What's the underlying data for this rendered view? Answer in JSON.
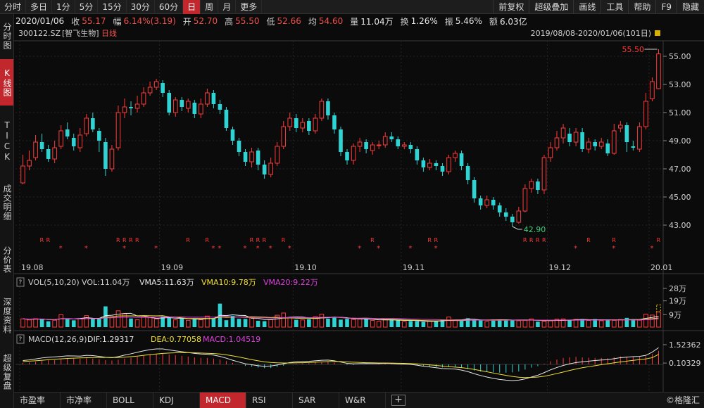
{
  "toolbar": {
    "left": [
      "分时",
      "多日",
      "1分",
      "5分",
      "15分",
      "30分",
      "60分",
      "日",
      "周",
      "月",
      "更多"
    ],
    "active": "日",
    "right": [
      "前复权",
      "超级叠加",
      "画线",
      "工具",
      "帮助",
      "F9",
      "隐藏"
    ]
  },
  "info": {
    "date": "2020/01/06",
    "close_label": "收",
    "close": "55.17",
    "change_label": "幅",
    "change": "6.14%(3.19)",
    "open_label": "开",
    "open": "52.70",
    "high_label": "高",
    "high": "55.50",
    "low_label": "低",
    "low": "52.66",
    "avg_label": "均",
    "avg": "54.60",
    "vol_label": "量",
    "vol": "11.04万",
    "turnover_label": "换",
    "turnover": "1.26%",
    "amplitude_label": "振",
    "amplitude": "5.46%",
    "amount_label": "额",
    "amount": "6.03亿"
  },
  "left_tabs": [
    "分时图",
    "K线图",
    "TICK",
    "成交明细",
    "分价表",
    "深度资料",
    "超级复盘"
  ],
  "left_tab_active": "K线图",
  "stock": {
    "code": "300122.SZ",
    "name": "[智飞生物]",
    "period": "日线"
  },
  "range": "2019/08/08-2020/01/06(101日)",
  "price_axis": [
    "55.00",
    "53.00",
    "51.00",
    "49.00",
    "47.00",
    "45.00",
    "43.00"
  ],
  "date_axis": [
    "19.08",
    "19.09",
    "19.10",
    "19.11",
    "19.12",
    "20.01"
  ],
  "annotations": {
    "high": "55.50",
    "low": "42.90"
  },
  "vol_panel": {
    "title": "VOL(5,10,20)",
    "vol": "VOL:11.04万",
    "vma5": "VMA5:11.63万",
    "vma10": "VMA10:9.78万",
    "vma20": "VMA20:9.22万",
    "axis": [
      "28万",
      "19万",
      "9万"
    ]
  },
  "macd_panel": {
    "title": "MACD(12,26,9)",
    "dif": "DIF:1.29317",
    "dea": "DEA:0.77058",
    "macd": "MACD:1.04519",
    "axis": [
      "1.52362",
      "0.10329"
    ]
  },
  "bottom_tabs": [
    "市盈率",
    "市净率",
    "BOLL",
    "KDJ",
    "MACD",
    "RSI",
    "SAR",
    "W&R"
  ],
  "bottom_active": "MACD",
  "brand": "©格隆汇",
  "colors": {
    "up": "#ff3b3b",
    "down": "#2fd3d3",
    "yellow": "#f0e030",
    "magenta": "#e040e0",
    "white": "#e8e8e8",
    "active": "#c1272d"
  },
  "markers": {
    "r_label": "R",
    "star_label": "*"
  },
  "candles": [
    [
      46.0,
      47.2,
      48.0,
      45.9
    ],
    [
      47.2,
      47.6,
      48.3,
      46.9
    ],
    [
      47.8,
      48.9,
      49.4,
      47.6
    ],
    [
      48.9,
      48.4,
      49.5,
      48.2
    ],
    [
      48.4,
      47.7,
      48.7,
      47.5
    ],
    [
      47.7,
      48.5,
      49.0,
      47.4
    ],
    [
      48.6,
      49.7,
      50.1,
      48.4
    ],
    [
      49.8,
      49.3,
      50.3,
      49.1
    ],
    [
      49.2,
      48.6,
      49.5,
      48.3
    ],
    [
      48.5,
      49.4,
      49.9,
      48.2
    ],
    [
      49.5,
      50.6,
      50.9,
      49.3
    ],
    [
      50.6,
      49.8,
      51.0,
      49.6
    ],
    [
      49.7,
      49.0,
      49.9,
      48.2
    ],
    [
      48.9,
      47.0,
      49.2,
      46.5
    ],
    [
      47.0,
      48.4,
      48.7,
      46.8
    ],
    [
      48.5,
      51.0,
      51.5,
      48.3
    ],
    [
      51.0,
      51.4,
      52.0,
      50.6
    ],
    [
      51.4,
      51.3,
      51.8,
      50.8
    ],
    [
      51.3,
      51.6,
      52.2,
      51.0
    ],
    [
      51.6,
      52.4,
      52.8,
      51.4
    ],
    [
      52.4,
      52.8,
      53.2,
      52.2
    ],
    [
      52.8,
      53.2,
      53.4,
      52.6
    ],
    [
      53.1,
      52.4,
      53.3,
      52.1
    ],
    [
      52.4,
      51.0,
      52.6,
      50.8
    ],
    [
      51.0,
      51.9,
      52.1,
      50.7
    ],
    [
      51.9,
      51.4,
      52.1,
      51.1
    ],
    [
      51.3,
      51.8,
      52.0,
      51.0
    ],
    [
      51.7,
      50.9,
      51.9,
      50.6
    ],
    [
      50.9,
      51.6,
      52.0,
      50.6
    ],
    [
      51.6,
      52.4,
      52.7,
      51.4
    ],
    [
      52.4,
      51.6,
      52.6,
      51.3
    ],
    [
      51.6,
      51.2,
      51.9,
      50.9
    ],
    [
      51.2,
      49.9,
      51.4,
      49.7
    ],
    [
      49.8,
      49.0,
      50.0,
      48.7
    ],
    [
      49.0,
      48.2,
      49.2,
      47.9
    ],
    [
      48.2,
      47.5,
      48.4,
      47.2
    ],
    [
      47.5,
      48.2,
      48.5,
      47.1
    ],
    [
      48.3,
      47.3,
      48.5,
      46.9
    ],
    [
      47.3,
      46.6,
      47.6,
      46.3
    ],
    [
      46.6,
      47.4,
      47.8,
      46.4
    ],
    [
      47.4,
      48.6,
      48.9,
      47.2
    ],
    [
      48.6,
      50.0,
      50.4,
      48.4
    ],
    [
      50.0,
      50.6,
      51.0,
      49.7
    ],
    [
      50.6,
      49.9,
      50.9,
      49.6
    ],
    [
      49.9,
      50.3,
      50.6,
      49.6
    ],
    [
      50.4,
      49.7,
      50.6,
      49.4
    ],
    [
      49.7,
      50.6,
      50.9,
      49.5
    ],
    [
      50.6,
      51.8,
      52.0,
      50.4
    ],
    [
      51.8,
      50.8,
      52.0,
      50.5
    ],
    [
      50.8,
      49.8,
      51.0,
      49.5
    ],
    [
      49.8,
      48.2,
      50.0,
      47.9
    ],
    [
      48.2,
      47.6,
      48.4,
      47.3
    ],
    [
      47.6,
      48.6,
      48.8,
      47.3
    ],
    [
      48.6,
      48.9,
      49.2,
      48.2
    ],
    [
      48.9,
      48.4,
      49.1,
      48.1
    ],
    [
      48.3,
      48.7,
      48.9,
      48.0
    ],
    [
      48.7,
      48.7,
      49.0,
      48.4
    ],
    [
      48.7,
      49.3,
      49.6,
      48.5
    ],
    [
      49.3,
      49.1,
      49.6,
      48.9
    ],
    [
      49.1,
      48.6,
      49.3,
      48.4
    ],
    [
      48.6,
      48.7,
      48.9,
      48.4
    ],
    [
      48.7,
      48.4,
      48.9,
      48.1
    ],
    [
      48.4,
      47.6,
      48.6,
      47.3
    ],
    [
      47.6,
      47.1,
      47.8,
      46.8
    ],
    [
      47.1,
      47.4,
      47.7,
      46.9
    ],
    [
      47.4,
      47.2,
      47.6,
      46.9
    ],
    [
      47.2,
      46.8,
      47.4,
      46.5
    ],
    [
      46.8,
      47.8,
      48.0,
      46.6
    ],
    [
      47.8,
      48.1,
      48.3,
      47.5
    ],
    [
      48.1,
      47.2,
      48.3,
      46.9
    ],
    [
      47.2,
      46.2,
      47.4,
      45.9
    ],
    [
      46.2,
      44.9,
      46.4,
      44.6
    ],
    [
      44.9,
      44.4,
      45.1,
      44.1
    ],
    [
      44.4,
      44.8,
      45.1,
      44.2
    ],
    [
      44.8,
      44.4,
      45.0,
      44.1
    ],
    [
      44.4,
      43.9,
      44.6,
      43.6
    ],
    [
      43.9,
      43.6,
      44.2,
      43.3
    ],
    [
      43.6,
      43.2,
      43.8,
      42.9
    ],
    [
      43.2,
      44.0,
      44.3,
      43.1
    ],
    [
      44.0,
      45.6,
      45.9,
      43.9
    ],
    [
      45.6,
      46.1,
      46.3,
      45.3
    ],
    [
      46.1,
      45.5,
      46.3,
      45.2
    ],
    [
      45.5,
      47.8,
      48.0,
      45.2
    ],
    [
      47.8,
      48.5,
      48.9,
      47.5
    ],
    [
      48.5,
      49.2,
      49.7,
      48.3
    ],
    [
      49.2,
      49.9,
      50.2,
      48.8
    ],
    [
      49.5,
      48.9,
      49.9,
      48.6
    ],
    [
      48.9,
      49.6,
      49.9,
      48.6
    ],
    [
      49.6,
      48.4,
      49.9,
      48.2
    ],
    [
      48.4,
      48.9,
      49.2,
      48.1
    ],
    [
      48.9,
      48.6,
      49.1,
      48.3
    ],
    [
      48.6,
      48.9,
      49.2,
      48.4
    ],
    [
      48.8,
      48.1,
      49.1,
      47.9
    ],
    [
      48.1,
      49.7,
      50.2,
      48.0
    ],
    [
      49.9,
      50.1,
      50.4,
      49.6
    ],
    [
      50.1,
      48.9,
      50.3,
      48.2
    ],
    [
      48.6,
      48.5,
      49.0,
      48.3
    ],
    [
      48.4,
      50.0,
      50.3,
      48.2
    ],
    [
      50.0,
      51.8,
      52.4,
      49.8
    ],
    [
      51.98,
      53.2,
      53.5,
      51.8
    ],
    [
      52.7,
      55.17,
      55.5,
      52.66
    ]
  ],
  "volumes": [
    6.0,
    5.2,
    6.1,
    5.8,
    4.2,
    5.0,
    9.0,
    6.4,
    4.9,
    5.9,
    8.3,
    6.6,
    6.0,
    15.0,
    7.2,
    11.8,
    9.6,
    6.2,
    5.4,
    7.3,
    6.8,
    5.9,
    7.7,
    6.6,
    5.3,
    6.2,
    4.9,
    6.2,
    5.3,
    8.0,
    6.4,
    17.0,
    5.0,
    8.2,
    6.0,
    5.9,
    6.7,
    4.6,
    4.3,
    5.4,
    8.6,
    10.2,
    7.1,
    5.3,
    5.2,
    5.7,
    7.6,
    9.4,
    6.1,
    7.2,
    5.4,
    6.0,
    5.6,
    5.8,
    6.0,
    4.8,
    4.2,
    5.3,
    5.7,
    5.1,
    3.9,
    4.4,
    4.3,
    3.8,
    4.4,
    4.1,
    5.6,
    7.3,
    5.0,
    4.5,
    6.4,
    5.0,
    5.2,
    4.0,
    5.3,
    5.4,
    5.4,
    5.2,
    4.6,
    4.8,
    5.9,
    3.9,
    4.2,
    4.6,
    5.7,
    5.9,
    4.9,
    5.6,
    5.7,
    4.8,
    5.8,
    4.6,
    5.1,
    4.9,
    5.5,
    6.7,
    5.2,
    5.0,
    9.4,
    8.7,
    11.04
  ],
  "macd_hist": [
    0.12,
    0.15,
    0.2,
    0.28,
    0.32,
    0.34,
    0.4,
    0.46,
    0.45,
    0.44,
    0.48,
    0.45,
    0.4,
    0.33,
    0.3,
    0.36,
    0.45,
    0.52,
    0.6,
    0.7,
    0.78,
    0.82,
    0.82,
    0.76,
    0.72,
    0.66,
    0.6,
    0.54,
    0.5,
    0.5,
    0.45,
    0.38,
    0.26,
    0.12,
    0.0,
    -0.12,
    -0.18,
    -0.25,
    -0.3,
    -0.28,
    -0.2,
    -0.1,
    0.0,
    0.06,
    0.08,
    0.1,
    0.14,
    0.18,
    0.2,
    0.14,
    0.04,
    -0.06,
    -0.05,
    0.0,
    0.02,
    0.02,
    0.03,
    0.06,
    0.05,
    0.02,
    0.02,
    0.0,
    -0.06,
    -0.12,
    -0.16,
    -0.2,
    -0.24,
    -0.22,
    -0.2,
    -0.26,
    -0.36,
    -0.48,
    -0.56,
    -0.6,
    -0.62,
    -0.64,
    -0.64,
    -0.62,
    -0.55,
    -0.4,
    -0.25,
    -0.14,
    0.06,
    0.24,
    0.38,
    0.5,
    0.55,
    0.58,
    0.54,
    0.52,
    0.5,
    0.5,
    0.48,
    0.55,
    0.62,
    0.6,
    0.6,
    0.58,
    0.62,
    0.8,
    1.04519
  ],
  "macd_dif": [
    0.3,
    0.35,
    0.42,
    0.5,
    0.55,
    0.58,
    0.62,
    0.66,
    0.65,
    0.64,
    0.7,
    0.68,
    0.62,
    0.55,
    0.52,
    0.6,
    0.72,
    0.82,
    0.94,
    1.05,
    1.14,
    1.2,
    1.2,
    1.12,
    1.05,
    0.98,
    0.92,
    0.85,
    0.8,
    0.78,
    0.72,
    0.62,
    0.48,
    0.32,
    0.18,
    0.05,
    -0.03,
    -0.1,
    -0.15,
    -0.12,
    -0.05,
    0.05,
    0.14,
    0.2,
    0.22,
    0.24,
    0.28,
    0.32,
    0.33,
    0.28,
    0.18,
    0.08,
    0.05,
    0.06,
    0.07,
    0.06,
    0.06,
    0.08,
    0.07,
    0.04,
    0.02,
    0.0,
    -0.06,
    -0.14,
    -0.2,
    -0.26,
    -0.32,
    -0.34,
    -0.36,
    -0.44,
    -0.56,
    -0.72,
    -0.86,
    -0.98,
    -1.08,
    -1.16,
    -1.22,
    -1.25,
    -1.22,
    -1.12,
    -0.98,
    -0.84,
    -0.64,
    -0.42,
    -0.24,
    -0.08,
    0.04,
    0.14,
    0.2,
    0.25,
    0.3,
    0.34,
    0.36,
    0.44,
    0.52,
    0.56,
    0.6,
    0.62,
    0.7,
    0.95,
    1.29317
  ],
  "macd_dea": [
    0.22,
    0.25,
    0.28,
    0.32,
    0.36,
    0.4,
    0.43,
    0.46,
    0.48,
    0.5,
    0.52,
    0.53,
    0.54,
    0.54,
    0.53,
    0.54,
    0.56,
    0.6,
    0.64,
    0.7,
    0.76,
    0.8,
    0.85,
    0.88,
    0.9,
    0.91,
    0.91,
    0.9,
    0.88,
    0.86,
    0.84,
    0.8,
    0.74,
    0.66,
    0.57,
    0.47,
    0.37,
    0.28,
    0.2,
    0.15,
    0.12,
    0.11,
    0.11,
    0.12,
    0.13,
    0.15,
    0.17,
    0.19,
    0.22,
    0.23,
    0.22,
    0.19,
    0.17,
    0.15,
    0.13,
    0.12,
    0.11,
    0.11,
    0.1,
    0.09,
    0.08,
    0.06,
    0.04,
    0.0,
    -0.04,
    -0.08,
    -0.13,
    -0.17,
    -0.21,
    -0.25,
    -0.31,
    -0.39,
    -0.48,
    -0.57,
    -0.67,
    -0.76,
    -0.85,
    -0.93,
    -0.99,
    -1.02,
    -1.01,
    -0.98,
    -0.92,
    -0.82,
    -0.71,
    -0.59,
    -0.47,
    -0.36,
    -0.26,
    -0.18,
    -0.1,
    -0.02,
    0.05,
    0.12,
    0.19,
    0.25,
    0.31,
    0.37,
    0.42,
    0.52,
    0.77058
  ],
  "r_marks": [
    3,
    5,
    17,
    18,
    19,
    20,
    30,
    33,
    41,
    42,
    43,
    47,
    63,
    73,
    74,
    90,
    91,
    92,
    94,
    102,
    106,
    114
  ],
  "star_marks": [
    7,
    11,
    18,
    24,
    34,
    35,
    40,
    42,
    45,
    48,
    60,
    64,
    69,
    74,
    99,
    106,
    113
  ]
}
